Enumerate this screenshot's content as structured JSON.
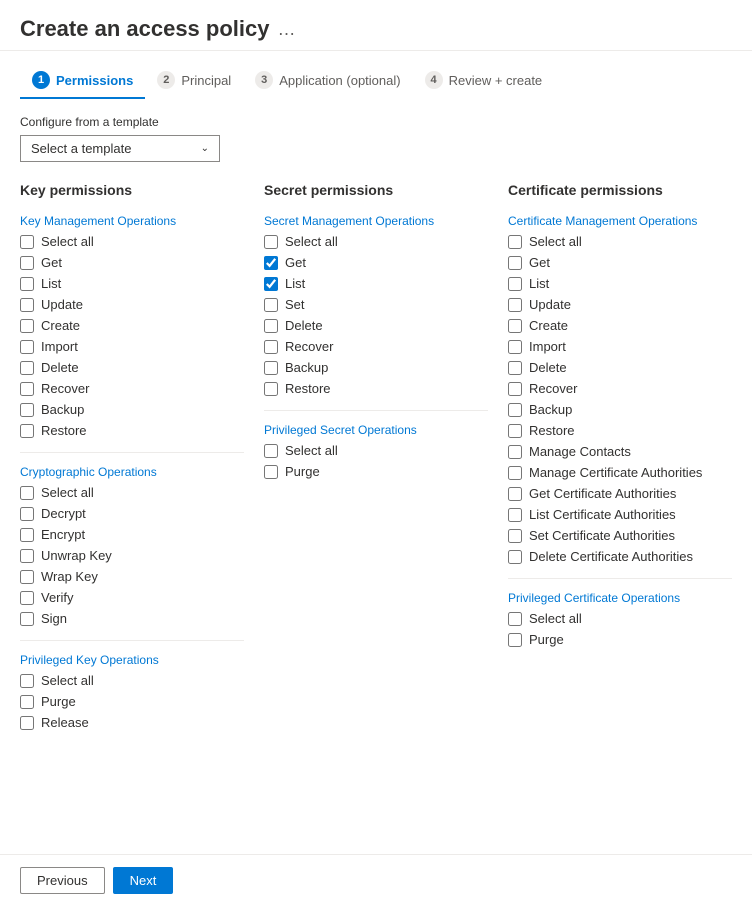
{
  "header": {
    "title": "Create an access policy",
    "more_icon": "…"
  },
  "wizard": {
    "steps": [
      {
        "id": "permissions",
        "num": "1",
        "label": "Permissions",
        "active": true
      },
      {
        "id": "principal",
        "num": "2",
        "label": "Principal",
        "active": false
      },
      {
        "id": "application",
        "num": "3",
        "label": "Application (optional)",
        "active": false
      },
      {
        "id": "review",
        "num": "4",
        "label": "Review + create",
        "active": false
      }
    ]
  },
  "template_section": {
    "label": "Configure from a template",
    "dropdown_placeholder": "Select a template"
  },
  "key_permissions": {
    "title": "Key permissions",
    "sections": [
      {
        "header": "Key Management Operations",
        "items": [
          {
            "label": "Select all",
            "checked": false
          },
          {
            "label": "Get",
            "checked": false
          },
          {
            "label": "List",
            "checked": false
          },
          {
            "label": "Update",
            "checked": false
          },
          {
            "label": "Create",
            "checked": false
          },
          {
            "label": "Import",
            "checked": false
          },
          {
            "label": "Delete",
            "checked": false
          },
          {
            "label": "Recover",
            "checked": false
          },
          {
            "label": "Backup",
            "checked": false
          },
          {
            "label": "Restore",
            "checked": false
          }
        ]
      },
      {
        "header": "Cryptographic Operations",
        "items": [
          {
            "label": "Select all",
            "checked": false
          },
          {
            "label": "Decrypt",
            "checked": false
          },
          {
            "label": "Encrypt",
            "checked": false
          },
          {
            "label": "Unwrap Key",
            "checked": false
          },
          {
            "label": "Wrap Key",
            "checked": false
          },
          {
            "label": "Verify",
            "checked": false
          },
          {
            "label": "Sign",
            "checked": false
          }
        ]
      },
      {
        "header": "Privileged Key Operations",
        "items": [
          {
            "label": "Select all",
            "checked": false
          },
          {
            "label": "Purge",
            "checked": false
          },
          {
            "label": "Release",
            "checked": false
          }
        ]
      }
    ]
  },
  "secret_permissions": {
    "title": "Secret permissions",
    "sections": [
      {
        "header": "Secret Management Operations",
        "items": [
          {
            "label": "Select all",
            "checked": false
          },
          {
            "label": "Get",
            "checked": true
          },
          {
            "label": "List",
            "checked": true
          },
          {
            "label": "Set",
            "checked": false
          },
          {
            "label": "Delete",
            "checked": false
          },
          {
            "label": "Recover",
            "checked": false
          },
          {
            "label": "Backup",
            "checked": false
          },
          {
            "label": "Restore",
            "checked": false
          }
        ]
      },
      {
        "header": "Privileged Secret Operations",
        "items": [
          {
            "label": "Select all",
            "checked": false
          },
          {
            "label": "Purge",
            "checked": false
          }
        ]
      }
    ]
  },
  "certificate_permissions": {
    "title": "Certificate permissions",
    "sections": [
      {
        "header": "Certificate Management Operations",
        "items": [
          {
            "label": "Select all",
            "checked": false
          },
          {
            "label": "Get",
            "checked": false
          },
          {
            "label": "List",
            "checked": false
          },
          {
            "label": "Update",
            "checked": false
          },
          {
            "label": "Create",
            "checked": false
          },
          {
            "label": "Import",
            "checked": false
          },
          {
            "label": "Delete",
            "checked": false
          },
          {
            "label": "Recover",
            "checked": false
          },
          {
            "label": "Backup",
            "checked": false
          },
          {
            "label": "Restore",
            "checked": false
          },
          {
            "label": "Manage Contacts",
            "checked": false
          },
          {
            "label": "Manage Certificate Authorities",
            "checked": false
          },
          {
            "label": "Get Certificate Authorities",
            "checked": false
          },
          {
            "label": "List Certificate Authorities",
            "checked": false
          },
          {
            "label": "Set Certificate Authorities",
            "checked": false
          },
          {
            "label": "Delete Certificate Authorities",
            "checked": false
          }
        ]
      },
      {
        "header": "Privileged Certificate Operations",
        "items": [
          {
            "label": "Select all",
            "checked": false
          },
          {
            "label": "Purge",
            "checked": false
          }
        ]
      }
    ]
  },
  "footer": {
    "previous_label": "Previous",
    "next_label": "Next"
  }
}
